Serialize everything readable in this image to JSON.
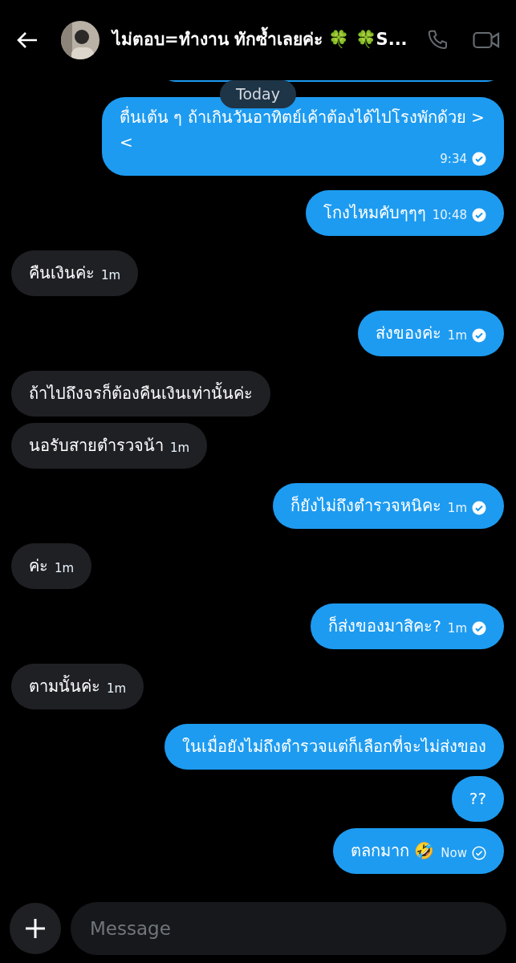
{
  "header": {
    "title": "ไม่ตอบ=ทำงาน ทักซ้ำเลยค่ะ 🍀 🍀S..."
  },
  "date_separator": "Today",
  "messages": [
    {
      "kind": "sent",
      "text": "ตื่นเต้น ๆ ถ้าเกินวันอาทิตย์เค้าต้องได้ไปโรงพักด้วย ><",
      "time": "9:34",
      "read": true
    },
    {
      "kind": "sent",
      "text": "โกงไหมคับๆๆๆ",
      "time": "10:48",
      "read": true
    },
    {
      "kind": "received",
      "text": "คืนเงินค่ะ",
      "time": "1m"
    },
    {
      "kind": "sent",
      "text": "ส่งของค่ะ",
      "time": "1m",
      "read": true
    },
    {
      "kind": "received",
      "text": "ถ้าไปถึงจรก็ต้องคืนเงินเท่านั้นค่ะ"
    },
    {
      "kind": "received",
      "text": "นอรับสายตำรวจน้า",
      "time": "1m"
    },
    {
      "kind": "sent",
      "text": "ก็ยังไม่ถึงตำรวจหนิคะ",
      "time": "1m",
      "read": true
    },
    {
      "kind": "received",
      "text": "ค่ะ",
      "time": "1m"
    },
    {
      "kind": "sent",
      "text": "ก็ส่งของมาสิคะ?",
      "time": "1m",
      "read": true
    },
    {
      "kind": "received",
      "text": "ตามนั้นค่ะ",
      "time": "1m"
    },
    {
      "kind": "sent",
      "text": "ในเมื่อยังไม่ถึงตำรวจแต่ก็เลือกที่จะไม่ส่งของ"
    },
    {
      "kind": "sent",
      "text": "??"
    },
    {
      "kind": "sent",
      "text": "ตลกมาก 🤣",
      "time": "Now",
      "read": false
    }
  ],
  "composer": {
    "placeholder": "Message"
  }
}
